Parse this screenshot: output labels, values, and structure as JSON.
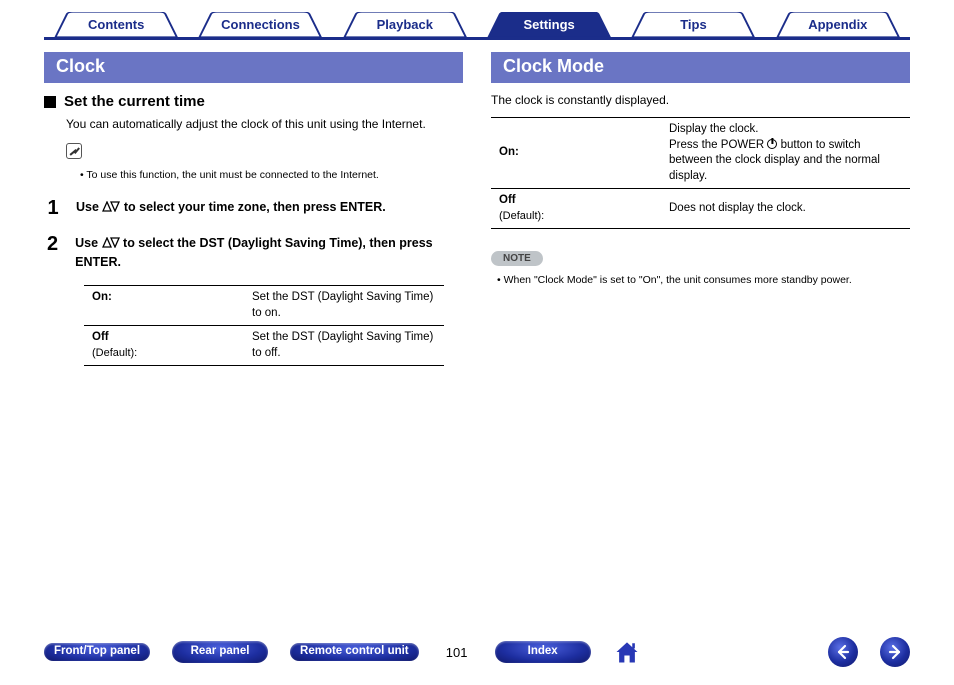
{
  "tabs": {
    "contents": "Contents",
    "connections": "Connections",
    "playback": "Playback",
    "settings": "Settings",
    "tips": "Tips",
    "appendix": "Appendix",
    "active": "settings"
  },
  "left": {
    "header": "Clock",
    "subhead": "Set the current time",
    "intro": "You can automatically adjust the clock of this unit using the Internet.",
    "pencil_note": "To use this function, the unit must be connected to the Internet.",
    "steps": {
      "s1_pre": "Use ",
      "s1_post": " to select your time zone, then press ENTER.",
      "s2_pre": "Use ",
      "s2_post": " to select the DST (Daylight Saving Time), then press ENTER."
    },
    "dst_table": {
      "on_label": "On:",
      "on_desc": "Set the DST (Daylight Saving Time) to on.",
      "off_label": "Off",
      "off_default": "(Default):",
      "off_desc": "Set the DST (Daylight Saving Time) to off."
    }
  },
  "right": {
    "header": "Clock Mode",
    "intro": "The clock is constantly displayed.",
    "table": {
      "on_label": "On:",
      "on_desc_line1": "Display the clock.",
      "on_desc_pre": "Press the POWER ",
      "on_desc_post": " button to switch between the clock display and the normal display.",
      "off_label": "Off",
      "off_default": "(Default):",
      "off_desc": "Does not display the clock."
    },
    "note_badge": "NOTE",
    "note_text": "When \"Clock Mode\" is set to \"On\", the unit consumes more standby power."
  },
  "bottom": {
    "front_top": "Front/Top panel",
    "rear": "Rear panel",
    "remote": "Remote control unit",
    "page": "101",
    "index": "Index"
  }
}
